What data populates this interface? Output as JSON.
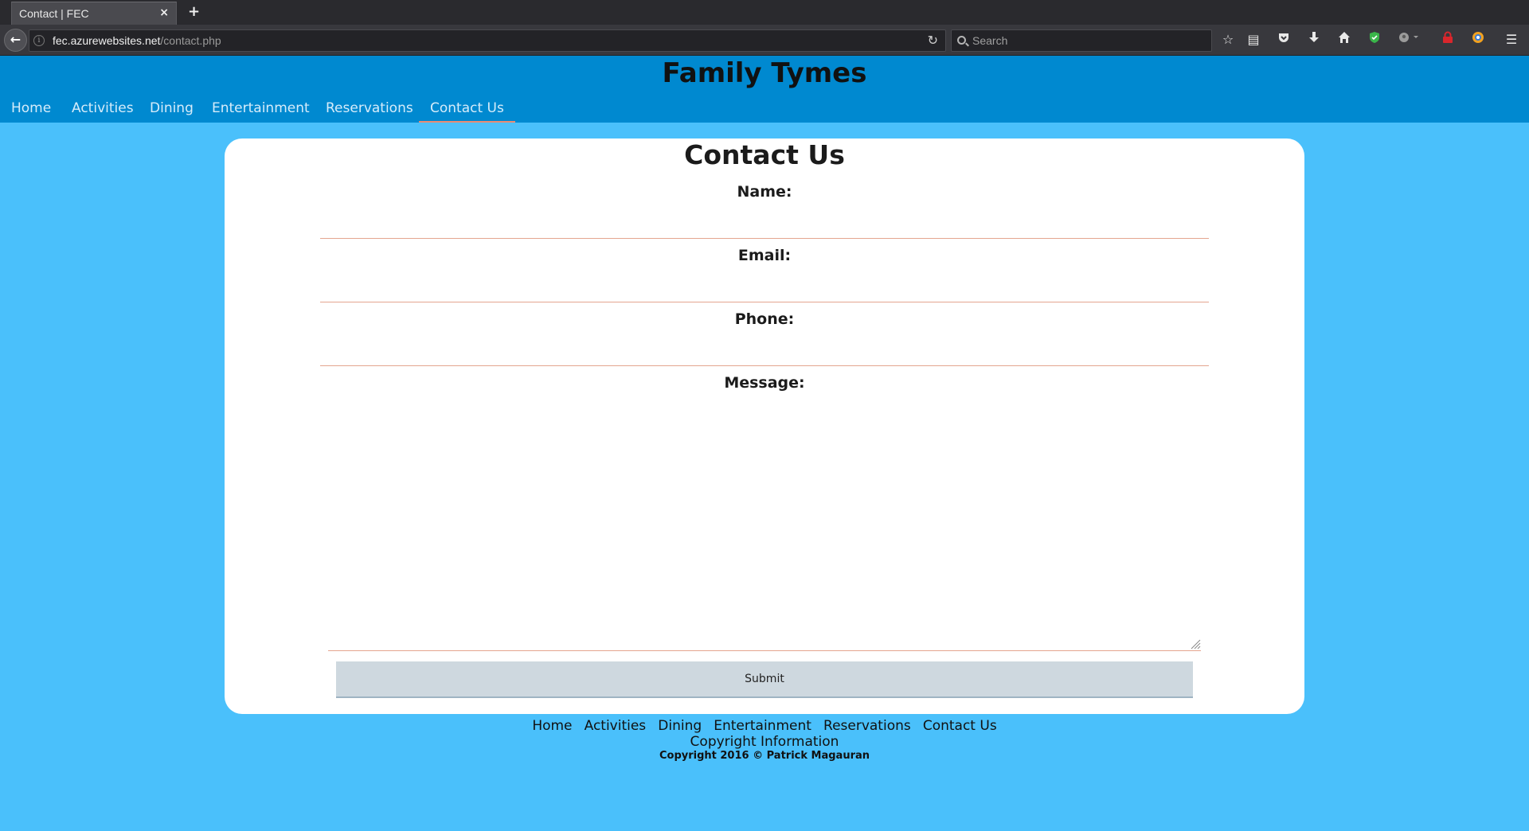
{
  "browser": {
    "tab_title": "Contact | FEC",
    "tab_close": "×",
    "new_tab": "+",
    "url_domain": "fec.azurewebsites.net",
    "url_path": "/contact.php",
    "search_placeholder": "Search",
    "toolbar_icons": [
      "bookmark-star-icon",
      "reading-list-icon",
      "pocket-icon",
      "download-icon",
      "home-icon",
      "shield-extension-icon",
      "user-menu-icon",
      "lock-extension-icon",
      "browser-extension-icon",
      "hamburger-menu-icon"
    ]
  },
  "site": {
    "title": "Family Tymes",
    "nav": [
      "Home",
      "Activities",
      "Dining",
      "Entertainment",
      "Reservations",
      "Contact Us"
    ],
    "active_nav": "Contact Us"
  },
  "form": {
    "heading": "Contact Us",
    "name_label": "Name:",
    "email_label": "Email:",
    "phone_label": "Phone:",
    "message_label": "Message:",
    "name_value": "",
    "email_value": "",
    "phone_value": "",
    "message_value": "",
    "submit_label": "Submit"
  },
  "footer": {
    "links": [
      "Home",
      "Activities",
      "Dining",
      "Entertainment",
      "Reservations",
      "Contact Us"
    ],
    "copyright_info": "Copyright Information",
    "copyright": "Copyright 2016 © Patrick Magauran"
  },
  "colors": {
    "header_bg": "#0089d0",
    "page_bg": "#4ac0fb",
    "active_underline": "#e98b74",
    "input_underline": "#e4a58f",
    "submit_bg": "#ced8df"
  }
}
